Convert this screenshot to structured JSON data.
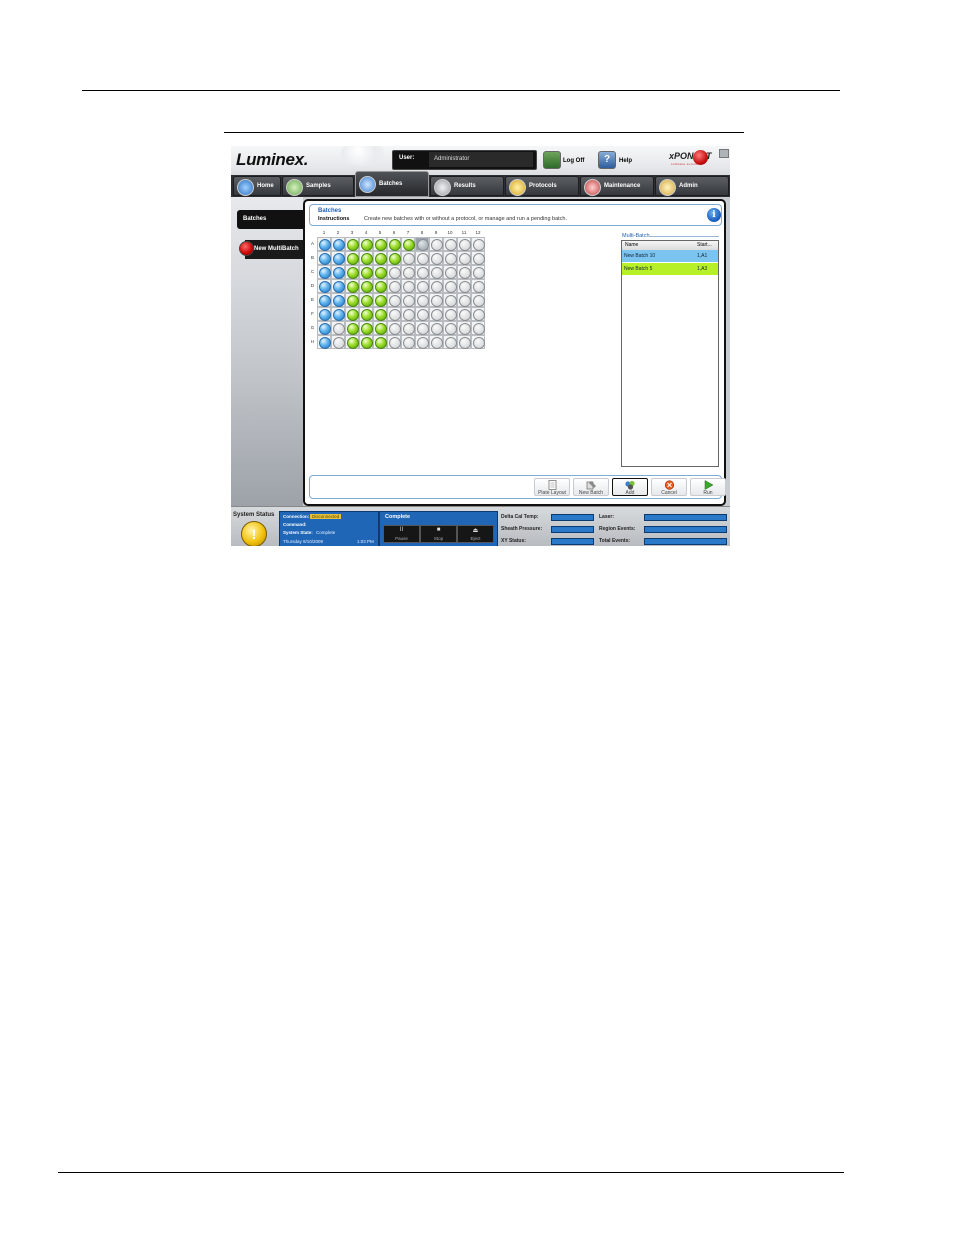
{
  "header": {
    "logo": "Luminex.",
    "user_label": "User:",
    "user_name": "Administrator",
    "logoff_label": "Log Off",
    "help_label": "Help",
    "help_glyph": "?",
    "brand": "xPONENT",
    "brand_sub": "software solutions"
  },
  "nav": {
    "tabs": [
      {
        "label": "Home"
      },
      {
        "label": "Samples"
      },
      {
        "label": "Batches"
      },
      {
        "label": "Results"
      },
      {
        "label": "Protocols"
      },
      {
        "label": "Maintenance"
      },
      {
        "label": "Admin"
      }
    ],
    "active": "Batches"
  },
  "sidebar": {
    "items": [
      {
        "label": "Batches"
      },
      {
        "label": "New MultiBatch"
      }
    ]
  },
  "instructions": {
    "title": "Batches",
    "label": "Instructions",
    "text": "Create new batches with or without a protocol, or manage and run a pending batch.",
    "info_glyph": "i"
  },
  "plate": {
    "columns": [
      "1",
      "2",
      "3",
      "4",
      "5",
      "6",
      "7",
      "8",
      "9",
      "10",
      "11",
      "12"
    ],
    "rows": [
      "A",
      "B",
      "C",
      "D",
      "E",
      "F",
      "G",
      "H"
    ],
    "wells": [
      [
        "b",
        "b",
        "g",
        "g",
        "g",
        "g",
        "g",
        "s",
        "e",
        "e",
        "e",
        "e"
      ],
      [
        "b",
        "b",
        "g",
        "g",
        "g",
        "g",
        "e",
        "e",
        "e",
        "e",
        "e",
        "e"
      ],
      [
        "b",
        "b",
        "g",
        "g",
        "g",
        "e",
        "e",
        "e",
        "e",
        "e",
        "e",
        "e"
      ],
      [
        "b",
        "b",
        "g",
        "g",
        "g",
        "e",
        "e",
        "e",
        "e",
        "e",
        "e",
        "e"
      ],
      [
        "b",
        "b",
        "g",
        "g",
        "g",
        "e",
        "e",
        "e",
        "e",
        "e",
        "e",
        "e"
      ],
      [
        "b",
        "b",
        "g",
        "g",
        "g",
        "e",
        "e",
        "e",
        "e",
        "e",
        "e",
        "e"
      ],
      [
        "b",
        "e",
        "g",
        "g",
        "g",
        "e",
        "e",
        "e",
        "e",
        "e",
        "e",
        "e"
      ],
      [
        "b",
        "e",
        "g",
        "g",
        "g",
        "e",
        "e",
        "e",
        "e",
        "e",
        "e",
        "e"
      ]
    ],
    "legend": {
      "b": "New Batch 10",
      "g": "New Batch 5",
      "s": "next start well",
      "e": "empty"
    }
  },
  "multibatch": {
    "title": "Multi-Batch",
    "col_name": "Name",
    "col_start": "Start...",
    "rows": [
      {
        "name": "New Batch 10",
        "start": "1,A1",
        "color": "#7cc4f0"
      },
      {
        "name": "New Batch 5",
        "start": "1,A3",
        "color": "#b8f028"
      }
    ]
  },
  "actions": {
    "plate_layout": "Plate Layout",
    "new_batch": "New Batch",
    "add": "Add",
    "cancel": "Cancel",
    "run": "Run"
  },
  "status": {
    "title": "System Status",
    "warn_glyph": "!",
    "connection_label": "Connection:",
    "connection_value": "Disconnected",
    "command_label": "Command:",
    "system_state_label": "System State:",
    "system_state_value": "Complete",
    "date": "Thursday 9/10/2009",
    "time": "1:03 PM",
    "progress_title": "Complete",
    "pause": "Pause",
    "stop": "Stop",
    "eject": "Eject",
    "pause_glyph": "II",
    "stop_glyph": "■",
    "eject_glyph": "⏏",
    "delta_cal_temp": "Delta Cal Temp:",
    "sheath_pressure": "Sheath Pressure:",
    "xy_status": "XY Status:",
    "laser": "Laser:",
    "region_events": "Region Events:",
    "total_events": "Total Events:"
  },
  "colors": {
    "accent_blue": "#1f66b7",
    "panel_border": "#7eaad8"
  }
}
